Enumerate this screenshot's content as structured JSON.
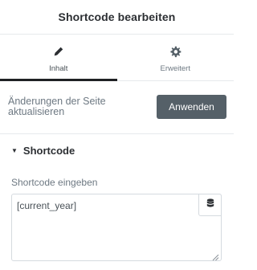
{
  "header": {
    "title": "Shortcode bearbeiten"
  },
  "tabs": [
    {
      "label": "Inhalt",
      "icon": "pencil-icon",
      "active": true
    },
    {
      "label": "Erweitert",
      "icon": "gear-icon",
      "active": false
    }
  ],
  "apply": {
    "text": "Änderungen der Seite aktualisieren",
    "button_label": "Anwenden"
  },
  "section": {
    "title": "Shortcode",
    "caret_icon": "caret-down-icon"
  },
  "field": {
    "label": "Shortcode eingeben",
    "value": "[current_year]",
    "dynamic_icon": "database-icon"
  },
  "colors": {
    "tab_active_indicator": "#1f2124",
    "apply_button": "#556068",
    "border": "#e6e9ec"
  }
}
